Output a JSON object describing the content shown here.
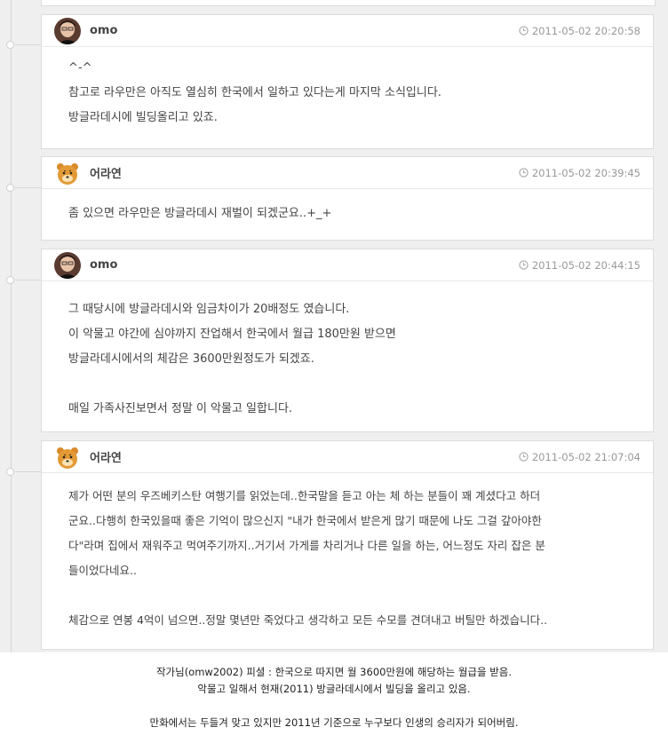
{
  "comments": [
    {
      "author": "omo",
      "avatar_icon": "person-avatar-icon",
      "date": "2011-05-02 20:20:58",
      "lines": [
        "^-^",
        "참고로 라우만은 아직도 열심히 한국에서 일하고 있다는게 마지막 소식입니다.",
        "방글라데시에 빌딩올리고 있죠."
      ]
    },
    {
      "author": "어라연",
      "avatar_icon": "bear-avatar-icon",
      "date": "2011-05-02 20:39:45",
      "lines": [
        "좀 있으면 라우만은 방글라데시 재벌이 되겠군요..+_+"
      ]
    },
    {
      "author": "omo",
      "avatar_icon": "person-avatar-icon",
      "date": "2011-05-02 20:44:15",
      "lines": [
        "그 때당시에 방글라데시와 임금차이가 20배정도 였습니다.",
        "이 악물고 야간에 심야까지 잔업해서 한국에서 월급 180만원 받으면",
        "방글라데시에서의 체감은 3600만원정도가 되겠죠.",
        "",
        "매일 가족사진보면서 정말 이 악물고 일합니다."
      ]
    },
    {
      "author": "어라연",
      "avatar_icon": "bear-avatar-icon",
      "date": "2011-05-02 21:07:04",
      "lines": [
        "제가 어떤 분의 우즈베키스탄 여행기를 읽었는데..한국말을 듣고 아는 체 하는 분들이 꽤 계셨다고 하더",
        "군요..다행히 한국있을때 좋은 기억이 많으신지 \"내가 한국에서 받은게 많기 때문에 나도 그걸 갚아야한",
        "다\"라며 집에서 재워주고 먹여주기까지..거기서 가게를 차리거나 다른 일을 하는, 어느정도 자리 잡은 분",
        "들이었다네요..",
        "",
        "체감으로 연봉 4억이 넘으면..정말 몇년만 죽었다고 생각하고 모든 수모를 견뎌내고 버틸만 하겠습니다.."
      ]
    }
  ],
  "footer": {
    "lines": [
      "작가님(omw2002) 피셜 : 한국으로 따지면 월 3600만원에 해당하는 월급을 받음.",
      "악물고 일해서 현재(2011) 방글라데시에서 빌딩을 올리고 있음.",
      "",
      "만화에서는 두들겨 맞고 있지만 2011년 기준으로 누구보다 인생의 승리자가 되어버림."
    ]
  }
}
